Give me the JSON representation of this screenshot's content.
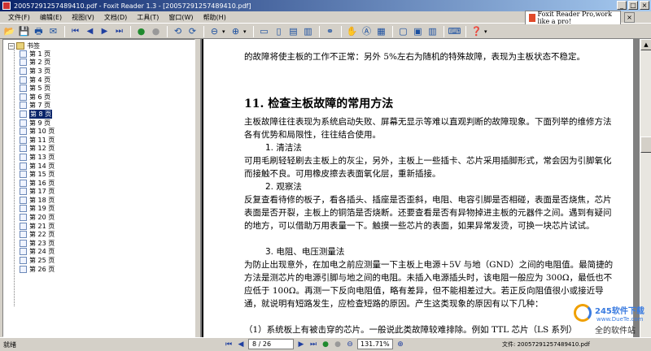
{
  "window": {
    "title": "20057291257489410.pdf - Foxit Reader 1.3 - [20057291257489410.pdf]",
    "controls": [
      "_",
      "□",
      "×"
    ]
  },
  "menu": [
    "文件(F)",
    "编辑(E)",
    "视图(V)",
    "文档(D)",
    "工具(T)",
    "窗口(W)",
    "帮助(H)"
  ],
  "ad": {
    "text": "Foxit Reader Pro,work like a pro!",
    "close": "×"
  },
  "bookmarks": {
    "root": "书签",
    "items": [
      "第 1 页",
      "第 2 页",
      "第 3 页",
      "第 4 页",
      "第 5 页",
      "第 6 页",
      "第 7 页",
      "第 8 页",
      "第 9 页",
      "第 10 页",
      "第 11 页",
      "第 12 页",
      "第 13 页",
      "第 14 页",
      "第 15 页",
      "第 16 页",
      "第 17 页",
      "第 18 页",
      "第 19 页",
      "第 20 页",
      "第 21 页",
      "第 22 页",
      "第 23 页",
      "第 24 页",
      "第 25 页",
      "第 26 页"
    ],
    "selected_index": 7
  },
  "document": {
    "line0": "的故障将使主板的工作不正常：另外 5%左右为随机的特殊故障，表现为主板状态不稳定。",
    "heading": "11.  检查主板故障的常用方法",
    "p1": "主板故障往往表现为系统启动失败、屏幕无显示等难以直观判断的故障现象。下面列举的维修方法各有优势和局限性，往往结合使用。",
    "s1": "1.  清洁法",
    "p2": "可用毛刷轻轻刷去主板上的灰尘，另外，主板上一些插卡、芯片采用插脚形式，常会因为引脚氧化而接触不良。可用橡皮擦去表面氧化层，重新插接。",
    "s2": "2.  观察法",
    "p3": "反复查看待修的板子，看各插头、插座是否歪斜，电阻、电容引脚是否相碰，表面是否烧焦，芯片表面是否开裂，主板上的铜箔是否烧断。还要查看是否有异物掉进主板的元器件之间。遇到有疑问的地方，可以借助万用表量一下。触摸一些芯片的表面，如果异常发烫，可换一块芯片试试。",
    "s3": "3.  电阻、电压测量法",
    "p4": "为防止出现意外，在加电之前应测量一下主板上电源＋5V 与地（GND）之间的电阻值。最简捷的方法是测芯片的电源引脚与地之间的电阻。未插入电源插头时，该电阻一般应为 300Ω，最低也不应低于 100Ω。再测一下反向电阻值，略有差异，但不能相差过大。若正反向阻值很小或接近导通，就说明有短路发生，应检查短路的原因。产生这类现象的原因有以下几种：",
    "p5": "（1）系统板上有被击穿的芯片。一般说此类故障较难排除。例如 TTL 芯片（LS 系列）"
  },
  "overlay": {
    "brand": "245软件下载",
    "site": "www.DueTe.com",
    "corner": "全的软件站"
  },
  "status": {
    "ready": "就绪",
    "page": "8 / 26",
    "zoom": "131.71%",
    "file": "文件: 20057291257489410.pdf"
  }
}
